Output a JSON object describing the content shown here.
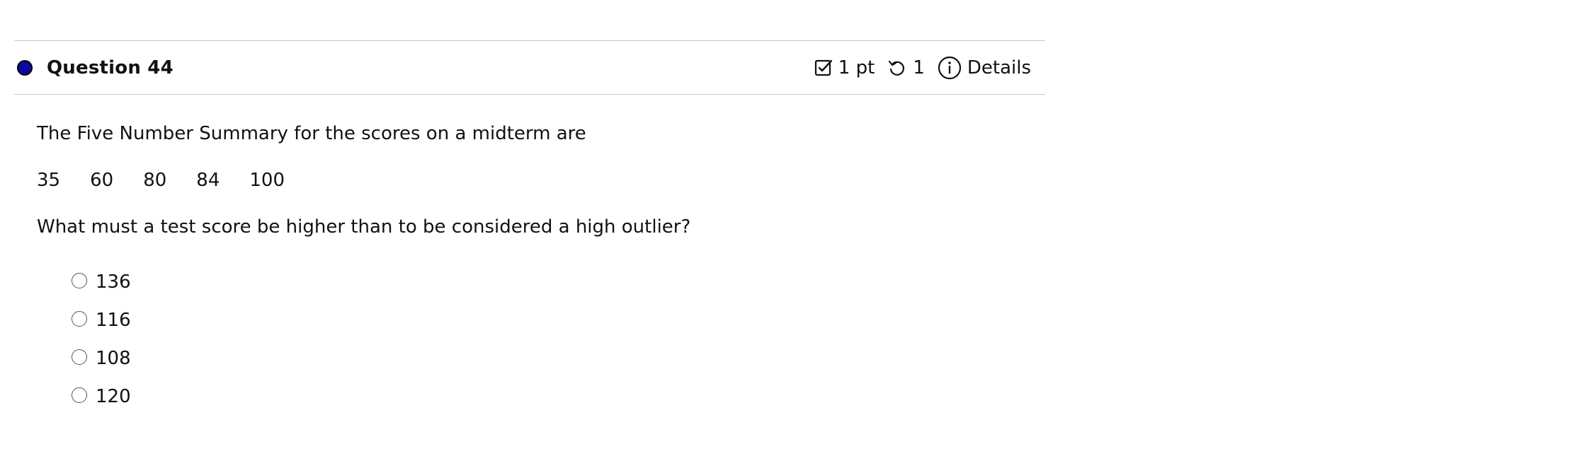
{
  "question": {
    "title": "Question 44",
    "points": "1 pt",
    "attempts": "1",
    "details_label": "Details",
    "status_color": "#0a0a9e",
    "icons": {
      "points": "checkbox-icon",
      "attempts": "retry-icon",
      "details": "info-icon"
    }
  },
  "body": {
    "prompt_intro": "The Five Number Summary for the scores on a midterm are",
    "summary_values": [
      "35",
      "60",
      "80",
      "84",
      "100"
    ],
    "prompt_question": "What must a test score be higher than to be considered a high outlier?"
  },
  "options": [
    "136",
    "116",
    "108",
    "120"
  ]
}
